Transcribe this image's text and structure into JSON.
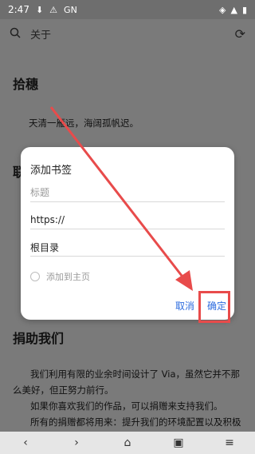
{
  "status_bar": {
    "time": "2:47",
    "badge": "GN"
  },
  "topbar": {
    "title": "关于"
  },
  "page": {
    "section1_title": "拾穗",
    "poem": "天清一雁远，海阔孤帆迟。",
    "section2_title_partial": "联",
    "section3_title": "捐助我们",
    "donate_lines": [
      "我们利用有限的业余时间设计了 Via，虽然它并不那么美好，但正努力前行。",
      "如果你喜欢我们的作品，可以捐赠来支持我们。",
      "所有的捐赠都将用来：提升我们的环境配置以及积极性。"
    ]
  },
  "dialog": {
    "title": "添加书签",
    "name_placeholder": "标题",
    "url_value": "https://",
    "folder_value": "根目录",
    "add_home_label": "添加到主页",
    "cancel_label": "取消",
    "confirm_label": "确定"
  },
  "colors": {
    "accent": "#2d6cdf",
    "annotation": "#e84b4b",
    "overlay": "#7a7a7a"
  }
}
